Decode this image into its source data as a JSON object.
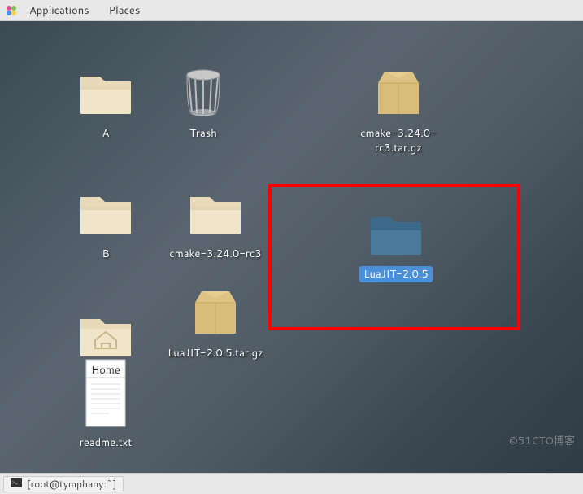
{
  "menubar": {
    "applications": "Applications",
    "places": "Places"
  },
  "desktop": {
    "icons": {
      "folder_a": "A",
      "trash": "Trash",
      "folder_b": "B",
      "cmake_folder": "cmake-3.24.0-rc3",
      "cmake_archive": "cmake-3.24.0-rc3.tar.gz",
      "luajit_folder": "LuaJIT-2.0.5",
      "luajit_archive": "LuaJIT-2.0.5.tar.gz",
      "home": "Home",
      "readme": "readme.txt"
    }
  },
  "taskbar": {
    "terminal": "[root@tymphany:~]"
  },
  "watermark": "©51CTO博客"
}
